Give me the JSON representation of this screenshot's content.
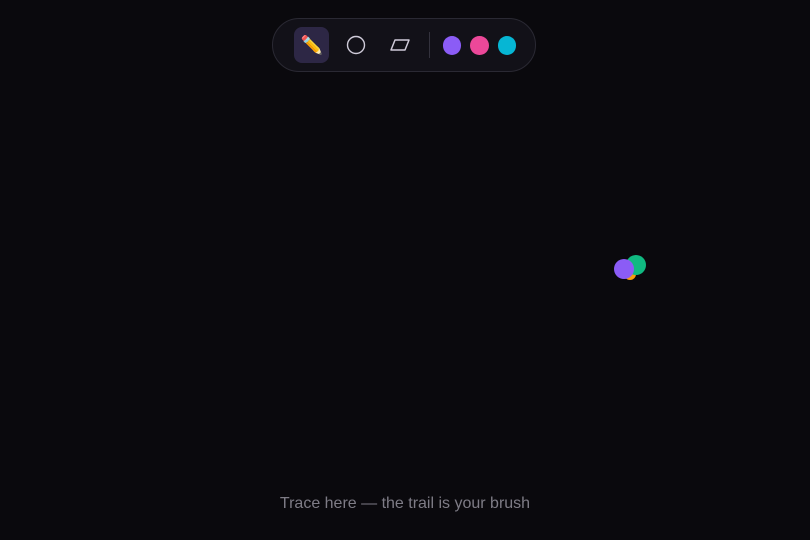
{
  "toolbar": {
    "tools": [
      {
        "id": "pencil",
        "icon": "pencil-icon",
        "glyph": "✏️",
        "active": true
      },
      {
        "id": "circle",
        "icon": "circle-icon",
        "active": false
      },
      {
        "id": "eraser",
        "icon": "eraser-icon",
        "active": false
      }
    ],
    "colors": [
      "#8b5cf6",
      "#ec4899",
      "#06b6d4"
    ]
  },
  "brush_trail": {
    "colors": [
      "#8b5cf6",
      "#10b981",
      "#f59e0b"
    ]
  },
  "hint": {
    "text": "Trace here — the trail is your brush"
  }
}
